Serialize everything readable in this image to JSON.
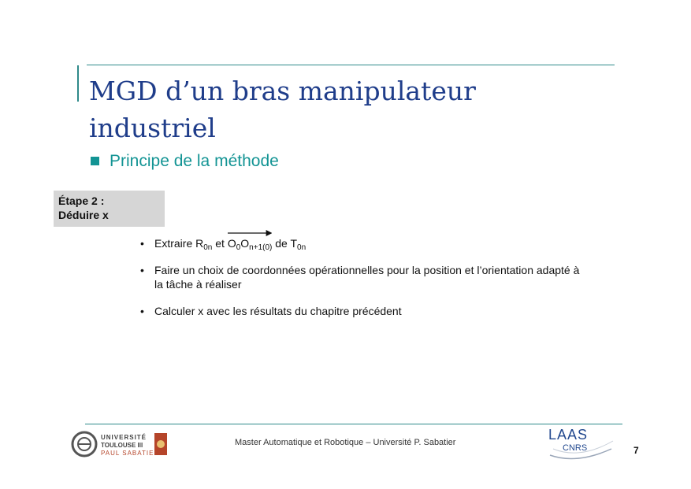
{
  "slide": {
    "title": "MGD d’un bras manipulateur industriel",
    "subtitle": "Principe de la méthode",
    "step_label_line1": "Étape 2 :",
    "step_label_line2": "Déduire x"
  },
  "items": {
    "bullet": "•",
    "item1": {
      "a": "Extraire R",
      "a_sub": "0n",
      "b": " et ",
      "v1": "O",
      "v1_sub": "0",
      "v2": "O",
      "v2_sub": "n+1(0)",
      "c": " de T",
      "c_sub": "0n"
    },
    "item2": "Faire un choix de coordonnées opérationnelles pour la position et l’orientation adapté à la tâche à réaliser",
    "item3": "Calculer x avec les résultats du chapitre précédent"
  },
  "footer": {
    "text": "Master Automatique et Robotique  –  Université P. Sabatier",
    "page_number": "7",
    "ut_logo_line1": "UNIVERSITÉ",
    "ut_logo_line2": "TOULOUSE III",
    "ut_logo_line3": "PAUL SABATIER",
    "laas_logo_line1": "LAAS",
    "laas_logo_line2": "CNRS"
  },
  "colors": {
    "title": "#1f3d8a",
    "accent": "#139494",
    "step_box": "#d6d6d6"
  }
}
